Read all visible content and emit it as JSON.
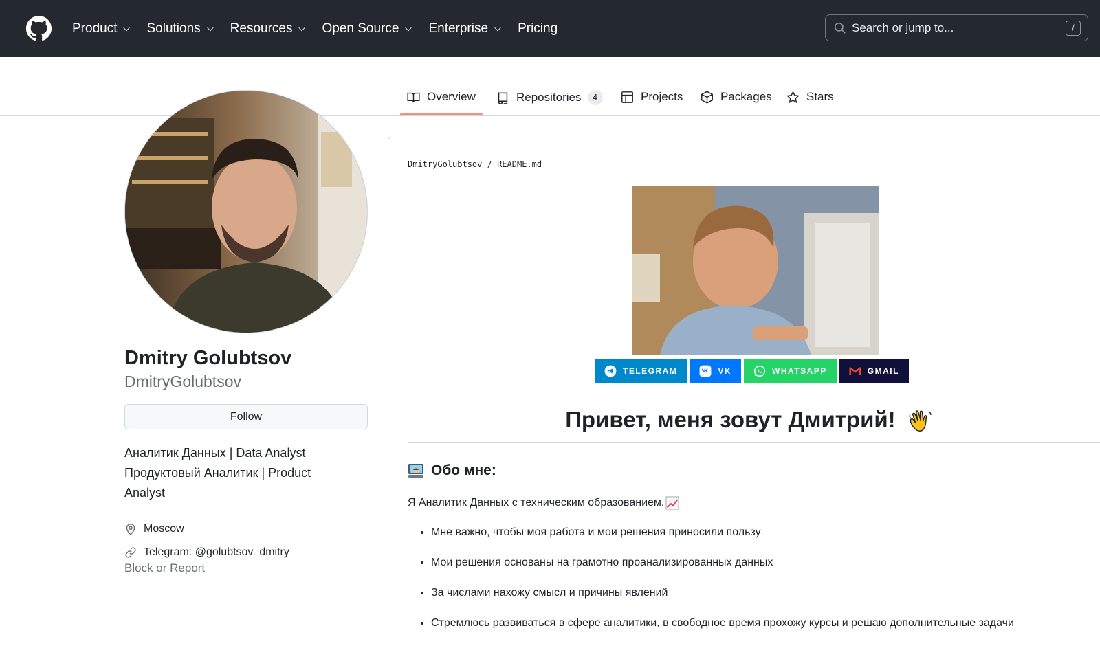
{
  "header": {
    "nav": [
      {
        "label": "Product",
        "dropdown": true
      },
      {
        "label": "Solutions",
        "dropdown": true
      },
      {
        "label": "Resources",
        "dropdown": true
      },
      {
        "label": "Open Source",
        "dropdown": true
      },
      {
        "label": "Enterprise",
        "dropdown": true
      },
      {
        "label": "Pricing",
        "dropdown": false
      }
    ],
    "search_placeholder": "Search or jump to...",
    "search_shortcut": "/"
  },
  "tabs": [
    {
      "label": "Overview",
      "icon": "book-icon",
      "active": true
    },
    {
      "label": "Repositories",
      "icon": "repo-icon",
      "count": "4"
    },
    {
      "label": "Projects",
      "icon": "table-icon"
    },
    {
      "label": "Packages",
      "icon": "package-icon"
    },
    {
      "label": "Stars",
      "icon": "star-icon"
    }
  ],
  "profile": {
    "name": "Dmitry Golubtsov",
    "login": "DmitryGolubtsov",
    "follow_label": "Follow",
    "bio_line1": "Аналитик Данных | Data Analyst",
    "bio_line2": "Продуктовый Аналитик | Product",
    "bio_line3": "Analyst",
    "location": "Moscow",
    "link": "Telegram: @golubtsov_dmitry",
    "block_report": "Block or Report"
  },
  "readme": {
    "owner": "DmitryGolubtsov",
    "separator": "/",
    "file": "README.md",
    "badges": [
      {
        "label": "TELEGRAM",
        "color": "#0088cc",
        "icon": "telegram-icon"
      },
      {
        "label": "VK",
        "color": "#0077ff",
        "icon": "vk-icon"
      },
      {
        "label": "WHATSAPP",
        "color": "#25d366",
        "icon": "whatsapp-icon"
      },
      {
        "label": "GMAIL",
        "color": "#10103a",
        "icon": "gmail-icon"
      }
    ],
    "greeting": "Привет, меня зовут Дмитрий!",
    "about_heading": "Обо мне:",
    "intro": "Я Аналитик Данных с техническим образованием.",
    "bullets": [
      "Мне важно, чтобы моя работа и мои решения приносили пользу",
      "Мои решения основаны на грамотно проанализированных данных",
      "За числами нахожу смысл и причины явлений",
      "Стремлюсь развиваться в сфере аналитики, в свободное время прохожу курсы и решаю дополнительные задачи"
    ]
  },
  "colors": {
    "header_bg": "#24292f",
    "tab_underline": "#fd8c73",
    "muted_text": "#656d76",
    "border": "#d0d7de"
  }
}
